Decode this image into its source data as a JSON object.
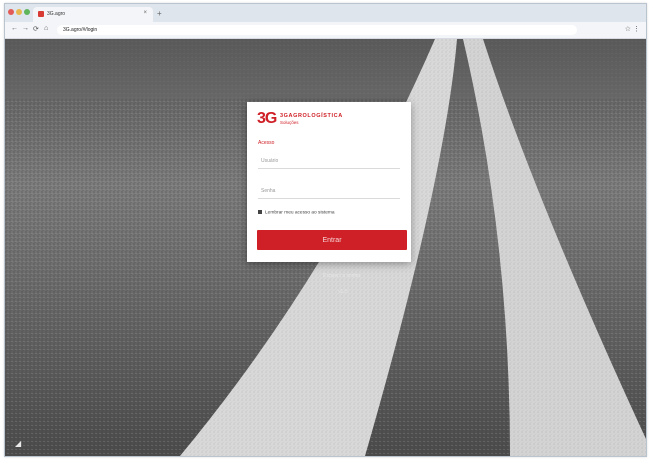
{
  "browser": {
    "tab_title": "3G.agro",
    "tab_close": "×",
    "new_tab": "+",
    "back": "←",
    "forward": "→",
    "reload": "⟳",
    "home": "⌂",
    "address": "3G.agro/#/login",
    "right_controls": "☆ ⋮",
    "traffic_colors": [
      "#e25b56",
      "#e8b84d",
      "#5fb55a"
    ]
  },
  "login": {
    "logo_mark": "3G",
    "brand": "3GAGROLOGÍSTICA",
    "brand_sub": "Soluções",
    "section": "Acesso",
    "user_placeholder": "Usuário",
    "password_placeholder": "Senha",
    "remember": "Lembrar meu acesso ao sistema",
    "submit": "Entrar",
    "forgot": "Esqueci a senha",
    "version": "v1.0"
  },
  "colors": {
    "accent": "#cf2027"
  }
}
